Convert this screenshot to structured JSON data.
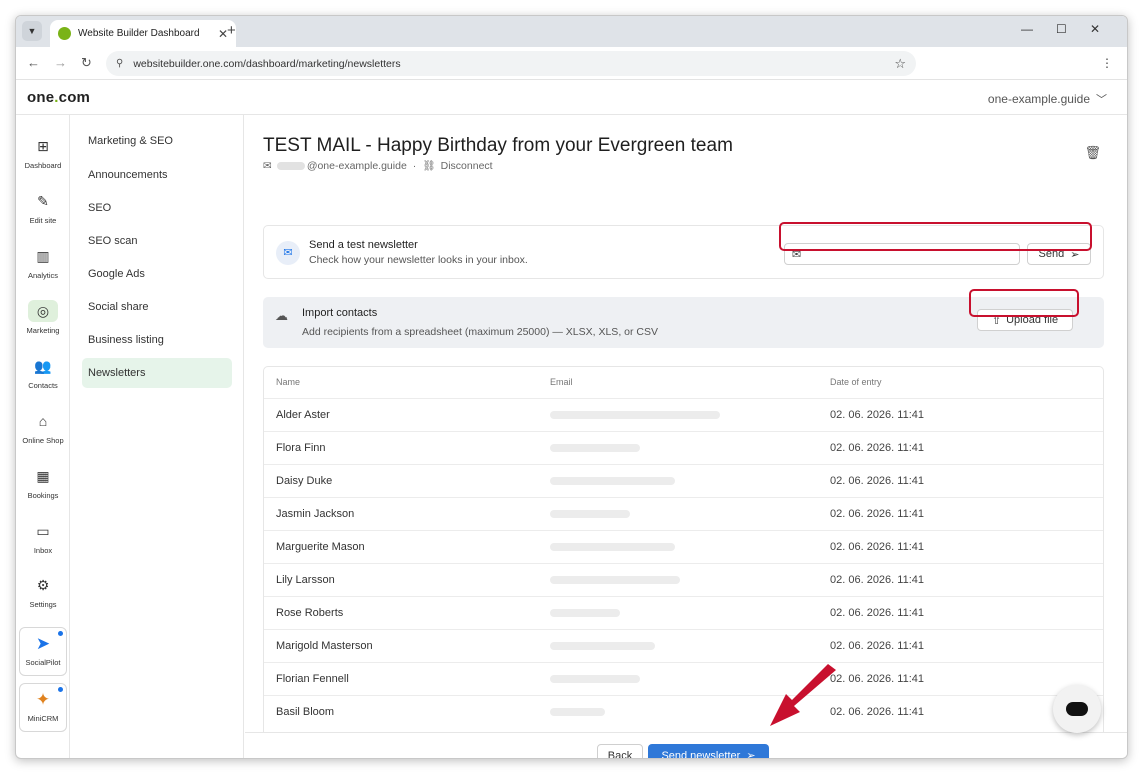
{
  "browser": {
    "tab_title": "Website Builder Dashboard",
    "tab_close": "✕",
    "new_tab": "+",
    "url": "websitebuilder.one.com/dashboard/marketing/newsletters",
    "window_controls": [
      "—",
      "☐",
      "✕"
    ]
  },
  "app": {
    "logo_main": "one",
    "logo_dot": ".",
    "logo_tail": "com",
    "domain": "one-example.guide"
  },
  "icon_nav": [
    {
      "label": "Dashboard",
      "icon": "⊞"
    },
    {
      "label": "Edit site",
      "icon": "✎"
    },
    {
      "label": "Analytics",
      "icon": "▥"
    },
    {
      "label": "Marketing",
      "icon": "◎"
    },
    {
      "label": "Contacts",
      "icon": "👥"
    },
    {
      "label": "Online Shop",
      "icon": "⌂"
    },
    {
      "label": "Bookings",
      "icon": "▦"
    },
    {
      "label": "Inbox",
      "icon": "▭"
    },
    {
      "label": "Settings",
      "icon": "⚙"
    }
  ],
  "apps": [
    {
      "label": "SocialPilot",
      "icon": "➤"
    },
    {
      "label": "MiniCRM",
      "icon": "✦"
    }
  ],
  "subnav": [
    "Marketing & SEO",
    "Announcements",
    "SEO",
    "SEO scan",
    "Google Ads",
    "Social share",
    "Business listing",
    "Newsletters"
  ],
  "page": {
    "title": "TEST MAIL - Happy Birthday from your Evergreen team",
    "sender_suffix": "@one-example.guide",
    "separator": "·",
    "disconnect": "Disconnect"
  },
  "test_newsletter": {
    "title": "Send a test newsletter",
    "subtitle": "Check how your newsletter looks in your inbox.",
    "email_value": "",
    "send_label": "Send"
  },
  "import": {
    "title": "Import contacts",
    "subtitle": "Add recipients from a spreadsheet (maximum 25000) — XLSX, XLS, or CSV",
    "upload_label": "Upload file"
  },
  "table": {
    "headers": [
      "Name",
      "Email",
      "Date of entry"
    ],
    "rows": [
      {
        "name": "Alder Aster",
        "date": "02. 06. 2026. 11:41"
      },
      {
        "name": "Flora Finn",
        "date": "02. 06. 2026. 11:41"
      },
      {
        "name": "Daisy Duke",
        "date": "02. 06. 2026. 11:41"
      },
      {
        "name": "Jasmin Jackson",
        "date": "02. 06. 2026. 11:41"
      },
      {
        "name": "Marguerite Mason",
        "date": "02. 06. 2026. 11:41"
      },
      {
        "name": "Lily Larsson",
        "date": "02. 06. 2026. 11:41"
      },
      {
        "name": "Rose Roberts",
        "date": "02. 06. 2026. 11:41"
      },
      {
        "name": "Marigold Masterson",
        "date": "02. 06. 2026. 11:41"
      },
      {
        "name": "Florian Fennell",
        "date": "02. 06. 2026. 11:41"
      },
      {
        "name": "Basil Bloom",
        "date": "02. 06. 2026. 11:41"
      }
    ]
  },
  "footer": {
    "back_label": "Back",
    "send_newsletter_label": "Send newsletter"
  },
  "colors": {
    "accent_green": "#7ab317",
    "primary_blue": "#2f78d8",
    "highlight_red": "#c8102e"
  }
}
